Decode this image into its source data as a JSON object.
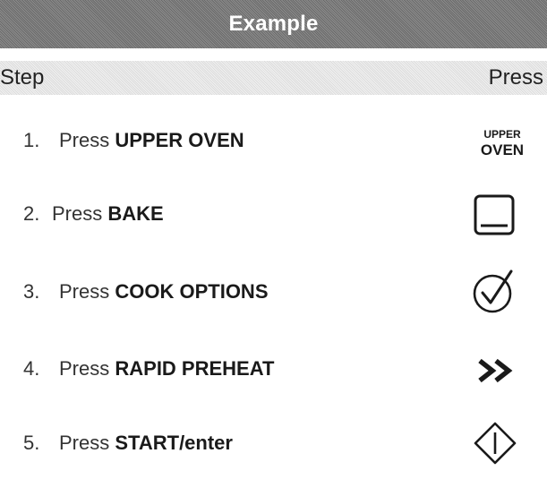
{
  "table": {
    "title": "Example",
    "column_step": "Step",
    "column_press": "Press"
  },
  "steps": [
    {
      "num": "1.",
      "text": "Press",
      "keyword": "UPPER OVEN",
      "key_icon": "upper-oven-key",
      "key_line1": "UPPER",
      "key_line2": "OVEN"
    },
    {
      "num": "2.",
      "text": "Press",
      "keyword": "BAKE",
      "key_icon": "bake-icon"
    },
    {
      "num": "3.",
      "text": "Press",
      "keyword": "COOK OPTIONS",
      "key_icon": "check-circle-icon"
    },
    {
      "num": "4.",
      "text": "Press",
      "keyword": "RAPID PREHEAT",
      "key_icon": "double-chevron-right-icon"
    },
    {
      "num": "5.",
      "text": "Press",
      "keyword": "START/enter",
      "key_icon": "start-diamond-icon"
    }
  ],
  "colors": {
    "title_bar": "#7a7a7a",
    "header_row": "#e6e6e6",
    "text": "#1a1a1a"
  }
}
